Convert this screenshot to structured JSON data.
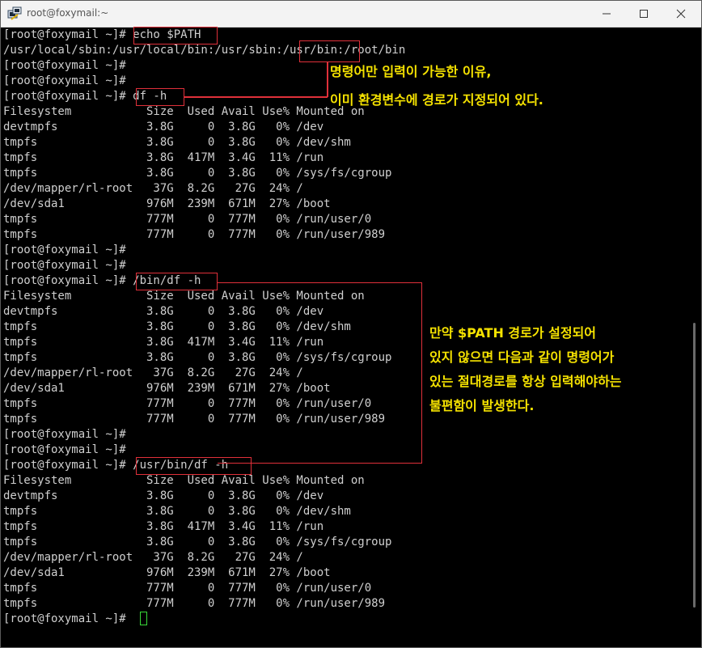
{
  "window": {
    "title": "root@foxymail:~"
  },
  "terminal": {
    "lines": [
      "[root@foxymail ~]# echo $PATH",
      "/usr/local/sbin:/usr/local/bin:/usr/sbin:/usr/bin:/root/bin",
      "[root@foxymail ~]#",
      "[root@foxymail ~]#",
      "[root@foxymail ~]# df -h",
      "Filesystem           Size  Used Avail Use% Mounted on",
      "devtmpfs             3.8G     0  3.8G   0% /dev",
      "tmpfs                3.8G     0  3.8G   0% /dev/shm",
      "tmpfs                3.8G  417M  3.4G  11% /run",
      "tmpfs                3.8G     0  3.8G   0% /sys/fs/cgroup",
      "/dev/mapper/rl-root   37G  8.2G   27G  24% /",
      "/dev/sda1            976M  239M  671M  27% /boot",
      "tmpfs                777M     0  777M   0% /run/user/0",
      "tmpfs                777M     0  777M   0% /run/user/989",
      "[root@foxymail ~]#",
      "[root@foxymail ~]#",
      "[root@foxymail ~]# /bin/df -h",
      "Filesystem           Size  Used Avail Use% Mounted on",
      "devtmpfs             3.8G     0  3.8G   0% /dev",
      "tmpfs                3.8G     0  3.8G   0% /dev/shm",
      "tmpfs                3.8G  417M  3.4G  11% /run",
      "tmpfs                3.8G     0  3.8G   0% /sys/fs/cgroup",
      "/dev/mapper/rl-root   37G  8.2G   27G  24% /",
      "/dev/sda1            976M  239M  671M  27% /boot",
      "tmpfs                777M     0  777M   0% /run/user/0",
      "tmpfs                777M     0  777M   0% /run/user/989",
      "[root@foxymail ~]#",
      "[root@foxymail ~]#",
      "[root@foxymail ~]# /usr/bin/df -h",
      "Filesystem           Size  Used Avail Use% Mounted on",
      "devtmpfs             3.8G     0  3.8G   0% /dev",
      "tmpfs                3.8G     0  3.8G   0% /dev/shm",
      "tmpfs                3.8G  417M  3.4G  11% /run",
      "tmpfs                3.8G     0  3.8G   0% /sys/fs/cgroup",
      "/dev/mapper/rl-root   37G  8.2G   27G  24% /",
      "/dev/sda1            976M  239M  671M  27% /boot",
      "tmpfs                777M     0  777M   0% /run/user/0",
      "tmpfs                777M     0  777M   0% /run/user/989",
      "[root@foxymail ~]#"
    ]
  },
  "annotations": {
    "note1": [
      "명령어만 입력이 가능한 이유,",
      "이미 환경변수에 경로가 지정되어 있다."
    ],
    "note2": [
      "만약 $PATH 경로가 설정되어",
      "있지 않으면 다음과 같이 명령어가",
      "있는 절대경로를 항상 입력해야하는",
      "불편함이 발생한다."
    ]
  },
  "colors": {
    "terminal_text": "#cfcfcf",
    "highlight_box": "#e0303a",
    "annotation_text": "#f5e200",
    "cursor": "#38d938"
  },
  "icons": {
    "app": "putty-icon",
    "minimize": "minimize-icon",
    "maximize": "maximize-icon",
    "close": "close-icon"
  }
}
